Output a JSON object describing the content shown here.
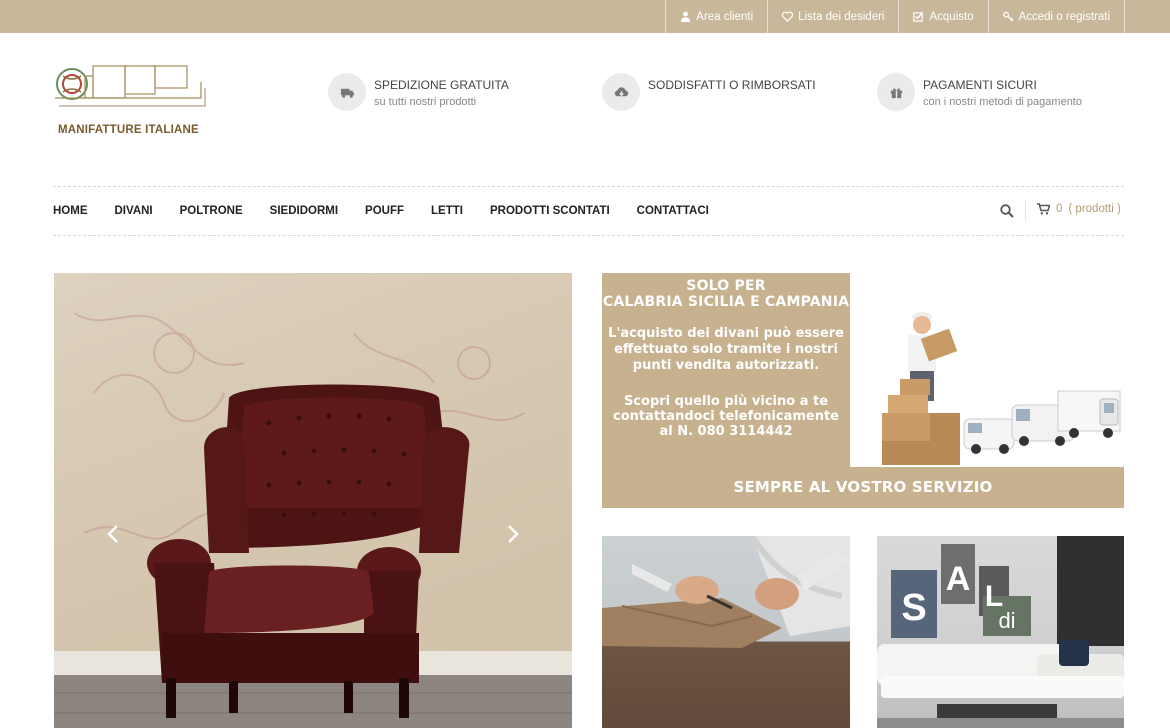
{
  "topbar": {
    "links": [
      {
        "label": "Area clienti",
        "icon": "user-icon"
      },
      {
        "label": "Lista dei desideri",
        "icon": "heart-icon"
      },
      {
        "label": "Acquisto",
        "icon": "checkbox-icon"
      },
      {
        "label": "Accedi o registrati",
        "icon": "key-icon"
      }
    ]
  },
  "logo": {
    "text": "MANIFATTURE ITALIANE"
  },
  "features": [
    {
      "title": "SPEDIZIONE GRATUITA",
      "subtitle": "su tutti nostri prodotti",
      "icon": "truck-icon"
    },
    {
      "title": "SODDISFATTI O RIMBORSATI",
      "subtitle": "",
      "icon": "cloud-download-icon"
    },
    {
      "title": "PAGAMENTI SICURI",
      "subtitle": "con i nostri metodi di pagamento",
      "icon": "gift-icon"
    }
  ],
  "nav": {
    "items": [
      "HOME",
      "DIVANI",
      "POLTRONE",
      "SIEDIDORMI",
      "POUFF",
      "LETTI",
      "PRODOTTI SCONTATI",
      "CONTATTACI"
    ],
    "cart_count": "0",
    "cart_label": "( prodotti )"
  },
  "promo": {
    "line1": "SOLO PER",
    "line2": "CALABRIA SICILIA E CAMPANIA",
    "body": "L'acquisto dei divani può essere effettuato solo tramite i nostri punti vendita autorizzati.",
    "body2": "Scopri quello più vicino a te contattandoci telefonicamente al N. 080 3114442",
    "footer": "SEMPRE AL VOSTRO SERVIZIO"
  },
  "saldi": {
    "letters": [
      "S",
      "A",
      "L",
      "di"
    ]
  },
  "colors": {
    "accent": "#c9b79c",
    "promo": "#c7b18f",
    "cart": "#b49b6f"
  }
}
